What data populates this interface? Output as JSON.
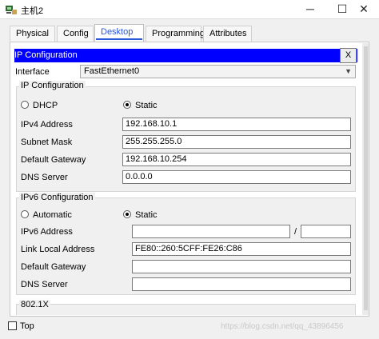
{
  "window": {
    "title": "主机2",
    "minimize": "─",
    "maximize": "☐",
    "close": "✕",
    "icon": "router-pc-icon"
  },
  "tabs": [
    {
      "label": "Physical",
      "active": false
    },
    {
      "label": "Config",
      "active": false
    },
    {
      "label": "Desktop",
      "active": true
    },
    {
      "label": "Programming",
      "active": false
    },
    {
      "label": "Attributes",
      "active": false
    }
  ],
  "ip_config": {
    "header": "IP Configuration",
    "close_label": "X",
    "interface_label": "Interface",
    "interface_value": "FastEthernet0",
    "ipv4": {
      "group_title": "IP Configuration",
      "dhcp_label": "DHCP",
      "static_label": "Static",
      "mode": "Static",
      "fields": {
        "ipv4_address": {
          "label": "IPv4 Address",
          "value": "192.168.10.1"
        },
        "subnet_mask": {
          "label": "Subnet Mask",
          "value": "255.255.255.0"
        },
        "default_gateway": {
          "label": "Default Gateway",
          "value": "192.168.10.254"
        },
        "dns_server": {
          "label": "DNS Server",
          "value": "0.0.0.0"
        }
      }
    },
    "ipv6": {
      "group_title": "IPv6 Configuration",
      "automatic_label": "Automatic",
      "static_label": "Static",
      "mode": "Static",
      "fields": {
        "ipv6_address": {
          "label": "IPv6 Address",
          "value": "",
          "prefix": "",
          "separator": "/"
        },
        "link_local": {
          "label": "Link Local Address",
          "value": "FE80::260:5CFF:FE26:C86"
        },
        "default_gateway": {
          "label": "Default Gateway",
          "value": ""
        },
        "dns_server": {
          "label": "DNS Server",
          "value": ""
        }
      }
    },
    "dot1x": {
      "group_title": "802.1X"
    }
  },
  "footer": {
    "top_label": "Top",
    "top_checked": false,
    "watermark": "https://blog.csdn.net/qq_43896456"
  },
  "colors": {
    "header_blue": "#0000ff",
    "active_tab": "#2a55d8"
  }
}
